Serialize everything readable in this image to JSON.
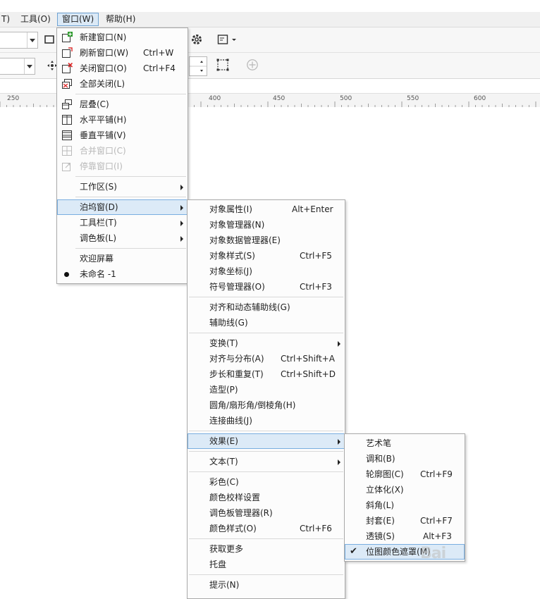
{
  "menubar": {
    "items": [
      {
        "label": "T)"
      },
      {
        "label": "工具(O)"
      },
      {
        "label": "窗口(W)"
      },
      {
        "label": "帮助(H)"
      }
    ]
  },
  "ruler": {
    "ticks": [
      "250",
      "400",
      "450",
      "500",
      "550",
      "600"
    ]
  },
  "window_menu": {
    "items": [
      {
        "label": "新建窗口(N)",
        "icon": "new-window-icon"
      },
      {
        "label": "刷新窗口(W)",
        "shortcut": "Ctrl+W",
        "icon": "refresh-window-icon"
      },
      {
        "label": "关闭窗口(O)",
        "shortcut": "Ctrl+F4",
        "icon": "close-window-icon"
      },
      {
        "label": "全部关闭(L)",
        "icon": "close-all-icon"
      },
      {
        "label": "层叠(C)",
        "icon": "cascade-icon"
      },
      {
        "label": "水平平铺(H)",
        "icon": "tile-horizontal-icon"
      },
      {
        "label": "垂直平铺(V)",
        "icon": "tile-vertical-icon"
      },
      {
        "label": "合并窗口(C)",
        "icon": "merge-window-icon",
        "disabled": true
      },
      {
        "label": "停靠窗口(I)",
        "icon": "dock-window-icon",
        "disabled": true
      },
      {
        "label": "工作区(S)"
      },
      {
        "label": "泊坞窗(D)"
      },
      {
        "label": "工具栏(T)"
      },
      {
        "label": "调色板(L)"
      },
      {
        "label": "欢迎屏幕"
      },
      {
        "label": "未命名 -1"
      }
    ]
  },
  "dockers_menu": {
    "items": [
      {
        "label": "对象属性(I)",
        "shortcut": "Alt+Enter"
      },
      {
        "label": "对象管理器(N)"
      },
      {
        "label": "对象数据管理器(E)"
      },
      {
        "label": "对象样式(S)",
        "shortcut": "Ctrl+F5"
      },
      {
        "label": "对象坐标(J)"
      },
      {
        "label": "符号管理器(O)",
        "shortcut": "Ctrl+F3"
      },
      {
        "label": "对齐和动态辅助线(G)"
      },
      {
        "label": "辅助线(G)"
      },
      {
        "label": "变换(T)"
      },
      {
        "label": "对齐与分布(A)",
        "shortcut": "Ctrl+Shift+A"
      },
      {
        "label": "步长和重复(T)",
        "shortcut": "Ctrl+Shift+D"
      },
      {
        "label": "造型(P)"
      },
      {
        "label": "圆角/扇形角/倒棱角(H)"
      },
      {
        "label": "连接曲线(J)"
      },
      {
        "label": "效果(E)"
      },
      {
        "label": "文本(T)"
      },
      {
        "label": "彩色(C)"
      },
      {
        "label": "颜色校样设置"
      },
      {
        "label": "调色板管理器(R)"
      },
      {
        "label": "颜色样式(O)",
        "shortcut": "Ctrl+F6"
      },
      {
        "label": "获取更多"
      },
      {
        "label": "托盘"
      },
      {
        "label": "提示(N)"
      }
    ]
  },
  "effects_menu": {
    "items": [
      {
        "label": "艺术笔"
      },
      {
        "label": "调和(B)"
      },
      {
        "label": "轮廓图(C)",
        "shortcut": "Ctrl+F9"
      },
      {
        "label": "立体化(X)"
      },
      {
        "label": "斜角(L)"
      },
      {
        "label": "封套(E)",
        "shortcut": "Ctrl+F7"
      },
      {
        "label": "透镜(S)",
        "shortcut": "Alt+F3"
      },
      {
        "label": "位图颜色遮罩(M)",
        "checked": true
      }
    ]
  },
  "watermark": {
    "text": "Bai"
  }
}
